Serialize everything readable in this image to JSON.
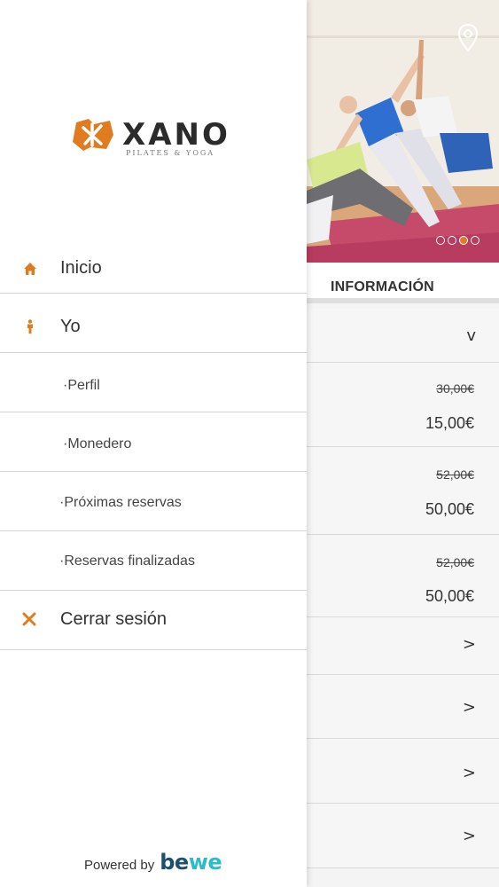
{
  "colors": {
    "accent": "#e07b1f",
    "text": "#333333",
    "divider": "#d4d4d4",
    "brand_dark": "#1e4f6e",
    "brand_light": "#2bbcc8"
  },
  "drawer": {
    "logo": {
      "name": "XANO",
      "tagline": "PILATES & YOGA"
    },
    "items": [
      {
        "label": "Inicio",
        "icon": "home-icon"
      },
      {
        "label": "Yo",
        "icon": "person-icon"
      },
      {
        "label": "·Perfil"
      },
      {
        "label": "·Monedero"
      },
      {
        "label": "·Próximas reservas"
      },
      {
        "label": "·Reservas finalizadas"
      },
      {
        "label": "Cerrar sesión",
        "icon": "close-icon"
      }
    ],
    "powered_by": "Powered by",
    "powered_brand": "bewe"
  },
  "background": {
    "carousel_active_index": 2,
    "carousel_count": 4,
    "section_title": "INFORMACIÓN",
    "rows": [
      {
        "chevron": "v"
      },
      {
        "old_price": "30,00€",
        "price": "15,00€"
      },
      {
        "old_price": "52,00€",
        "price": "50,00€"
      },
      {
        "old_price": "52,00€",
        "price": "50,00€"
      },
      {
        "chevron": ">"
      },
      {
        "chevron": ">"
      },
      {
        "chevron": ">"
      },
      {
        "chevron": ">"
      }
    ]
  }
}
